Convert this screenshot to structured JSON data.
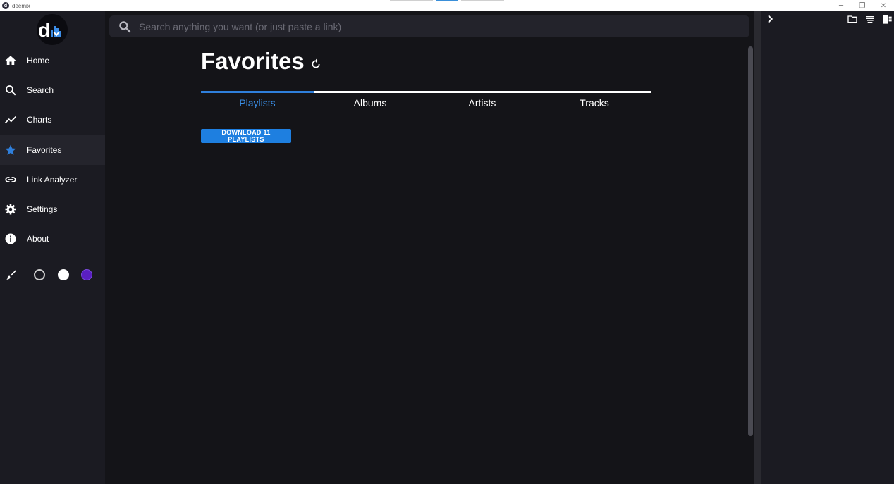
{
  "window": {
    "title": "deemix",
    "minimize_glyph": "─",
    "restore_glyph": "❐",
    "close_glyph": "✕"
  },
  "sidebar": {
    "logo_text": "d",
    "items": [
      {
        "label": "Home",
        "icon": "home-icon"
      },
      {
        "label": "Search",
        "icon": "search-icon"
      },
      {
        "label": "Charts",
        "icon": "chart-line-icon"
      },
      {
        "label": "Favorites",
        "icon": "star-icon",
        "active": true
      },
      {
        "label": "Link Analyzer",
        "icon": "link-icon"
      },
      {
        "label": "Settings",
        "icon": "gear-icon"
      },
      {
        "label": "About",
        "icon": "info-icon"
      }
    ],
    "themes": [
      {
        "name": "dark",
        "color": "#1b1b22"
      },
      {
        "name": "light",
        "color": "#ffffff"
      },
      {
        "name": "purple",
        "color": "#5a1fc2"
      }
    ]
  },
  "search": {
    "placeholder": "Search anything you want (or just paste a link)",
    "value": ""
  },
  "main": {
    "title": "Favorites",
    "tabs": [
      {
        "label": "Playlists",
        "active": true
      },
      {
        "label": "Albums"
      },
      {
        "label": "Artists"
      },
      {
        "label": "Tracks"
      }
    ],
    "download_label": "DOWNLOAD 11 PLAYLISTS"
  },
  "colors": {
    "accent": "#2f7fdb",
    "sidebar_bg": "#1b1b22",
    "main_bg": "#141418"
  }
}
